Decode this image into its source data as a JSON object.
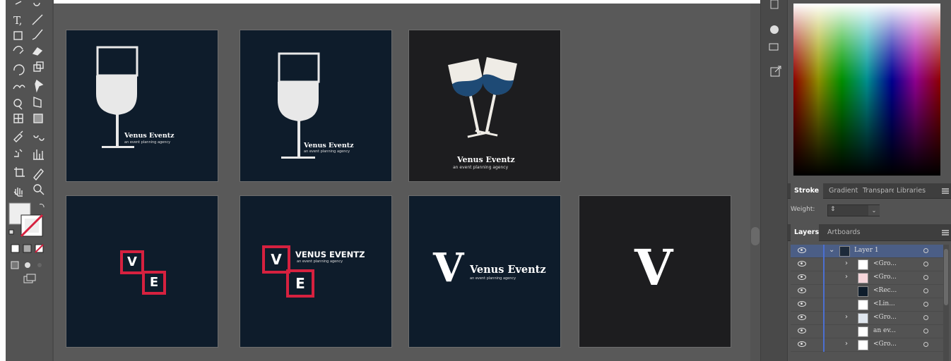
{
  "app": {
    "colors": {
      "artboard_navy": "#0e1c2b",
      "artboard_dark": "#1d1d1f",
      "accent_red": "#d6213f",
      "selection_blue": "#4b6fd1"
    }
  },
  "toolbar": {
    "tools": [
      {
        "icon": "pen-icon"
      },
      {
        "icon": "curvature-icon"
      },
      {
        "icon": "type-icon",
        "glyph": "T,"
      },
      {
        "icon": "line-icon",
        "glyph": "/"
      },
      {
        "icon": "rectangle-icon",
        "glyph": "□,"
      },
      {
        "icon": "paintbrush-icon"
      },
      {
        "icon": "shaper-icon"
      },
      {
        "icon": "eraser-icon"
      },
      {
        "icon": "rotate-icon"
      },
      {
        "icon": "scale-icon"
      },
      {
        "icon": "warp-icon"
      },
      {
        "icon": "pin-icon"
      },
      {
        "icon": "shape-builder-icon"
      },
      {
        "icon": "perspective-icon"
      },
      {
        "icon": "mesh-icon"
      },
      {
        "icon": "gradient-icon"
      },
      {
        "icon": "eyedropper-icon"
      },
      {
        "icon": "blend-icon"
      },
      {
        "icon": "symbol-sprayer-icon"
      },
      {
        "icon": "column-graph-icon"
      },
      {
        "icon": "artboard-icon"
      },
      {
        "icon": "slice-icon"
      },
      {
        "icon": "hand-icon"
      },
      {
        "icon": "zoom-icon"
      }
    ]
  },
  "artboards": {
    "ab1": {
      "brand": "Venus Eventz",
      "tagline": "an event planning agency"
    },
    "ab2": {
      "brand": "Venus Eventz",
      "tagline": "an event planning agency"
    },
    "ab3": {
      "brand": "Venus Eventz",
      "tagline": "an event planning agency"
    },
    "ab4": {
      "letter_v": "V",
      "letter_e": "E"
    },
    "ab5": {
      "letter_v": "V",
      "letter_e": "E",
      "brand": "VENUS EVENTZ",
      "tagline": "an event planning agency"
    },
    "ab6": {
      "mono": "V",
      "brand": "Venus Eventz",
      "tagline": "an event planning agency"
    },
    "ab7": {
      "mono": "V"
    }
  },
  "panels": {
    "stroke_tabs": [
      {
        "label": "Stroke",
        "active": true
      },
      {
        "label": "Gradient",
        "active": false
      },
      {
        "label": "Transparency",
        "active": false
      },
      {
        "label": "Libraries",
        "active": false
      }
    ],
    "weight_label": "Weight:",
    "layer_tabs": [
      {
        "label": "Layers",
        "active": true
      },
      {
        "label": "Artboards",
        "active": false
      }
    ],
    "layers": [
      {
        "name": "Layer 1",
        "level": 0
      },
      {
        "name": "<Gro...",
        "level": 1
      },
      {
        "name": "<Gro...",
        "level": 1
      },
      {
        "name": "<Rec...",
        "level": 1
      },
      {
        "name": "<Lin...",
        "level": 1
      },
      {
        "name": "<Gro...",
        "level": 1
      },
      {
        "name": "an ev...",
        "level": 1
      },
      {
        "name": "<Gro...",
        "level": 1
      }
    ]
  }
}
